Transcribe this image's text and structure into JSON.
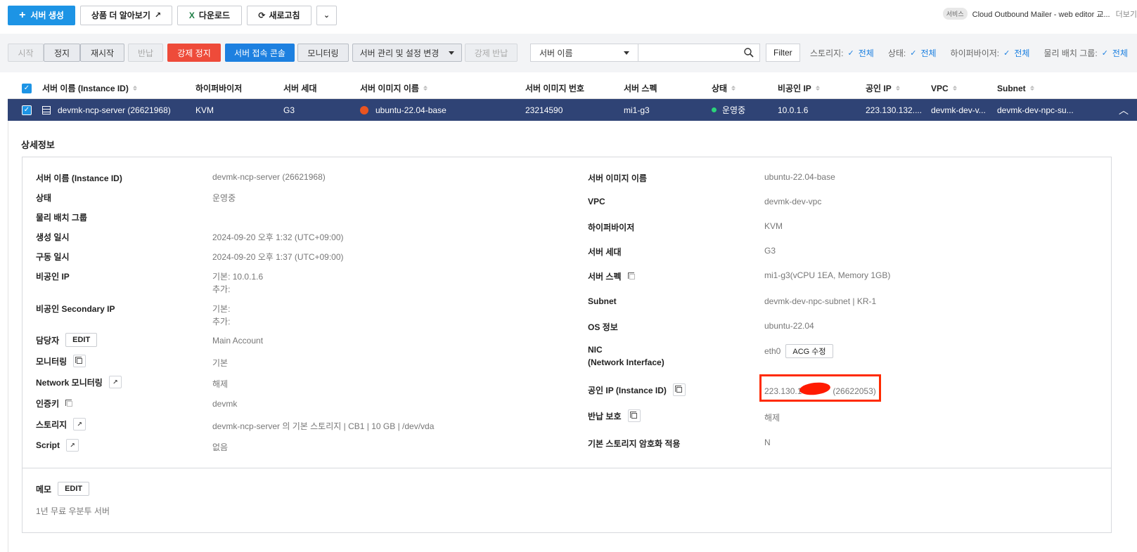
{
  "toolbar": {
    "create_label": "서버 생성",
    "learn_more_label": "상품 더 알아보기",
    "download_label": "다운로드",
    "refresh_label": "새로고침"
  },
  "service": {
    "badge": "서비스",
    "name": "Cloud Outbound Mailer - web editor 교...",
    "more": "더보기"
  },
  "actions": {
    "start": "시작",
    "stop": "정지",
    "restart": "재시작",
    "return": "반납",
    "force_stop": "강제 정지",
    "console": "서버 접속 콘솔",
    "monitoring": "모니터링",
    "manage": "서버 관리 및 설정 변경",
    "force_return": "강제 반납"
  },
  "search": {
    "select_value": "서버 이름",
    "placeholder": ""
  },
  "filter": {
    "label": "Filter",
    "items": [
      {
        "name": "스토리지:",
        "value": "전체"
      },
      {
        "name": "상태:",
        "value": "전체"
      },
      {
        "name": "하이퍼바이저:",
        "value": "전체"
      },
      {
        "name": "물리 배치 그룹:",
        "value": "전체"
      }
    ]
  },
  "table": {
    "headers": {
      "name": "서버 이름 (Instance ID)",
      "hypervisor": "하이퍼바이저",
      "generation": "서버 세대",
      "image_name": "서버 이미지 이름",
      "image_no": "서버 이미지 번호",
      "spec": "서버 스펙",
      "status": "상태",
      "private_ip": "비공인 IP",
      "public_ip": "공인 IP",
      "vpc": "VPC",
      "subnet": "Subnet"
    },
    "row": {
      "name": "devmk-ncp-server (26621968)",
      "hypervisor": "KVM",
      "generation": "G3",
      "image_name": "ubuntu-22.04-base",
      "image_no": "23214590",
      "spec": "mi1-g3",
      "status": "운영중",
      "private_ip": "10.0.1.6",
      "public_ip": "223.130.132....",
      "vpc": "devmk-dev-v...",
      "subnet": "devmk-dev-npc-su..."
    }
  },
  "detail": {
    "title": "상세정보",
    "left": {
      "server_name_label": "서버 이름 (Instance ID)",
      "server_name": "devmk-ncp-server (26621968)",
      "status_label": "상태",
      "status": "운영중",
      "placement_label": "물리 배치 그룹",
      "created_label": "생성 일시",
      "created": "2024-09-20 오후 1:32 (UTC+09:00)",
      "started_label": "구동 일시",
      "started": "2024-09-20 오후 1:37 (UTC+09:00)",
      "private_ip_label": "비공인 IP",
      "private_ip_main": "기본: 10.0.1.6",
      "private_ip_extra": "추가:",
      "secondary_label": "비공인 Secondary IP",
      "secondary_main": "기본:",
      "secondary_extra": "추가:",
      "owner_label": "담당자",
      "owner": "Main Account",
      "edit_label": "EDIT",
      "monitoring_label": "모니터링",
      "monitoring": "기본",
      "net_monitoring_label": "Network 모니터링",
      "net_monitoring": "해제",
      "auth_key_label": "인증키",
      "auth_key": "devmk",
      "storage_label": "스토리지",
      "storage": "devmk-ncp-server 의 기본 스토리지 | CB1 | 10 GB | /dev/vda",
      "script_label": "Script",
      "script": "없음"
    },
    "right": {
      "image_label": "서버 이미지 이름",
      "image": "ubuntu-22.04-base",
      "vpc_label": "VPC",
      "vpc": "devmk-dev-vpc",
      "hypervisor_label": "하이퍼바이저",
      "hypervisor": "KVM",
      "generation_label": "서버 세대",
      "generation": "G3",
      "spec_label": "서버 스펙",
      "spec": "mi1-g3(vCPU 1EA, Memory 1GB)",
      "subnet_label": "Subnet",
      "subnet": "devmk-dev-npc-subnet | KR-1",
      "os_label": "OS 정보",
      "os": "ubuntu-22.04",
      "nic_label_1": "NIC",
      "nic_label_2": "(Network Interface)",
      "nic": "eth0",
      "acg_label": "ACG 수정",
      "public_ip_label": "공인 IP (Instance ID)",
      "public_ip_prefix": "223.130.1",
      "public_ip_suffix": "(26622053)",
      "return_protect_label": "반납 보호",
      "return_protect": "해제",
      "encrypt_label": "기본 스토리지 암호화 적용",
      "encrypt": "N"
    },
    "memo_label": "메모",
    "memo_edit": "EDIT",
    "memo": "1년 무료 우분투 서버"
  }
}
